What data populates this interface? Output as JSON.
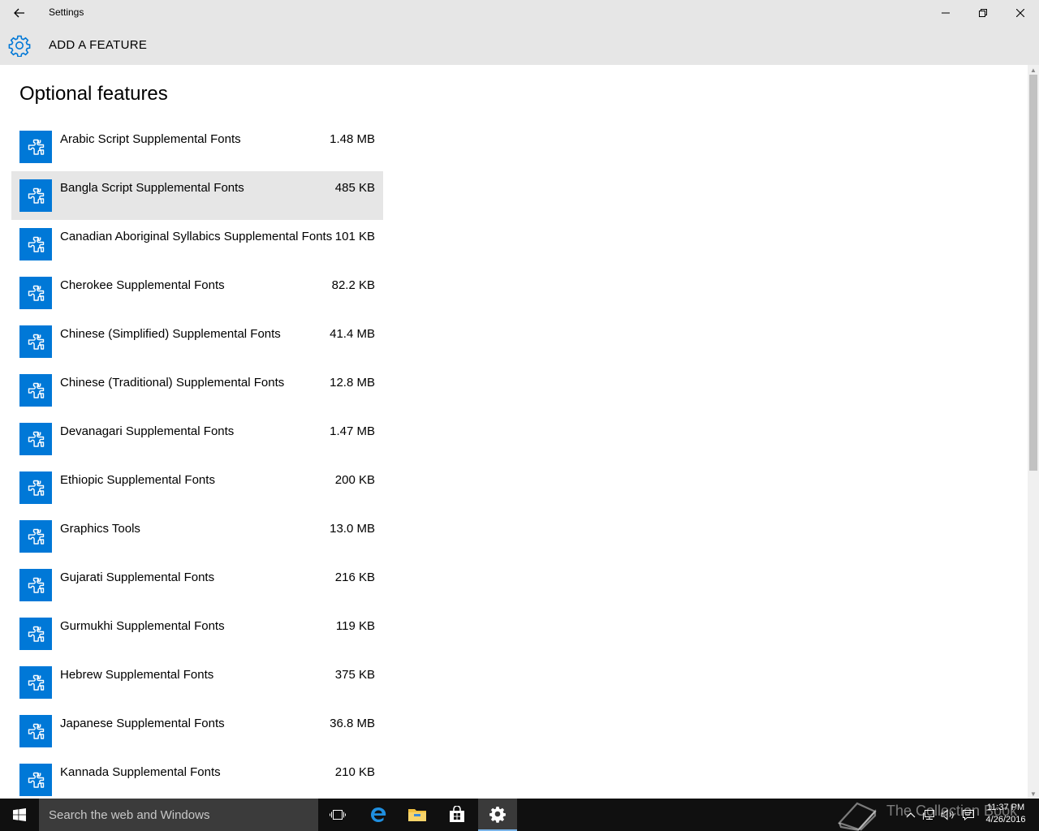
{
  "window": {
    "title": "Settings",
    "controls": [
      "minimize",
      "restore",
      "close"
    ]
  },
  "header": {
    "title": "ADD A FEATURE",
    "icon": "gear-icon"
  },
  "main": {
    "section_title": "Optional features",
    "features": [
      {
        "name": "Arabic Script Supplemental Fonts",
        "size": "1.48 MB",
        "selected": false
      },
      {
        "name": "Bangla Script Supplemental Fonts",
        "size": "485 KB",
        "selected": true
      },
      {
        "name": "Canadian Aboriginal Syllabics Supplemental Fonts",
        "size": "101 KB",
        "selected": false
      },
      {
        "name": "Cherokee Supplemental Fonts",
        "size": "82.2 KB",
        "selected": false
      },
      {
        "name": "Chinese (Simplified) Supplemental Fonts",
        "size": "41.4 MB",
        "selected": false
      },
      {
        "name": "Chinese (Traditional) Supplemental Fonts",
        "size": "12.8 MB",
        "selected": false
      },
      {
        "name": "Devanagari Supplemental Fonts",
        "size": "1.47 MB",
        "selected": false
      },
      {
        "name": "Ethiopic Supplemental Fonts",
        "size": "200 KB",
        "selected": false
      },
      {
        "name": "Graphics Tools",
        "size": "13.0 MB",
        "selected": false
      },
      {
        "name": "Gujarati Supplemental Fonts",
        "size": "216 KB",
        "selected": false
      },
      {
        "name": "Gurmukhi Supplemental Fonts",
        "size": "119 KB",
        "selected": false
      },
      {
        "name": "Hebrew Supplemental Fonts",
        "size": "375 KB",
        "selected": false
      },
      {
        "name": "Japanese Supplemental Fonts",
        "size": "36.8 MB",
        "selected": false
      },
      {
        "name": "Kannada Supplemental Fonts",
        "size": "210 KB",
        "selected": false
      }
    ]
  },
  "taskbar": {
    "search_placeholder": "Search the web and Windows",
    "pinned": [
      "task-view-icon",
      "edge-icon",
      "file-explorer-icon",
      "store-icon",
      "settings-icon"
    ],
    "active": "settings-icon",
    "tray_icons": [
      "chevron-up-icon",
      "network-icon",
      "volume-icon",
      "action-center-icon"
    ],
    "time": "11:37 PM",
    "date": "4/26/2016"
  },
  "watermark": {
    "text": "The Collection Book"
  },
  "colors": {
    "accent": "#0078d7",
    "chrome": "#e6e6e6",
    "selected_row": "#e6e6e6",
    "taskbar": "#101010"
  }
}
